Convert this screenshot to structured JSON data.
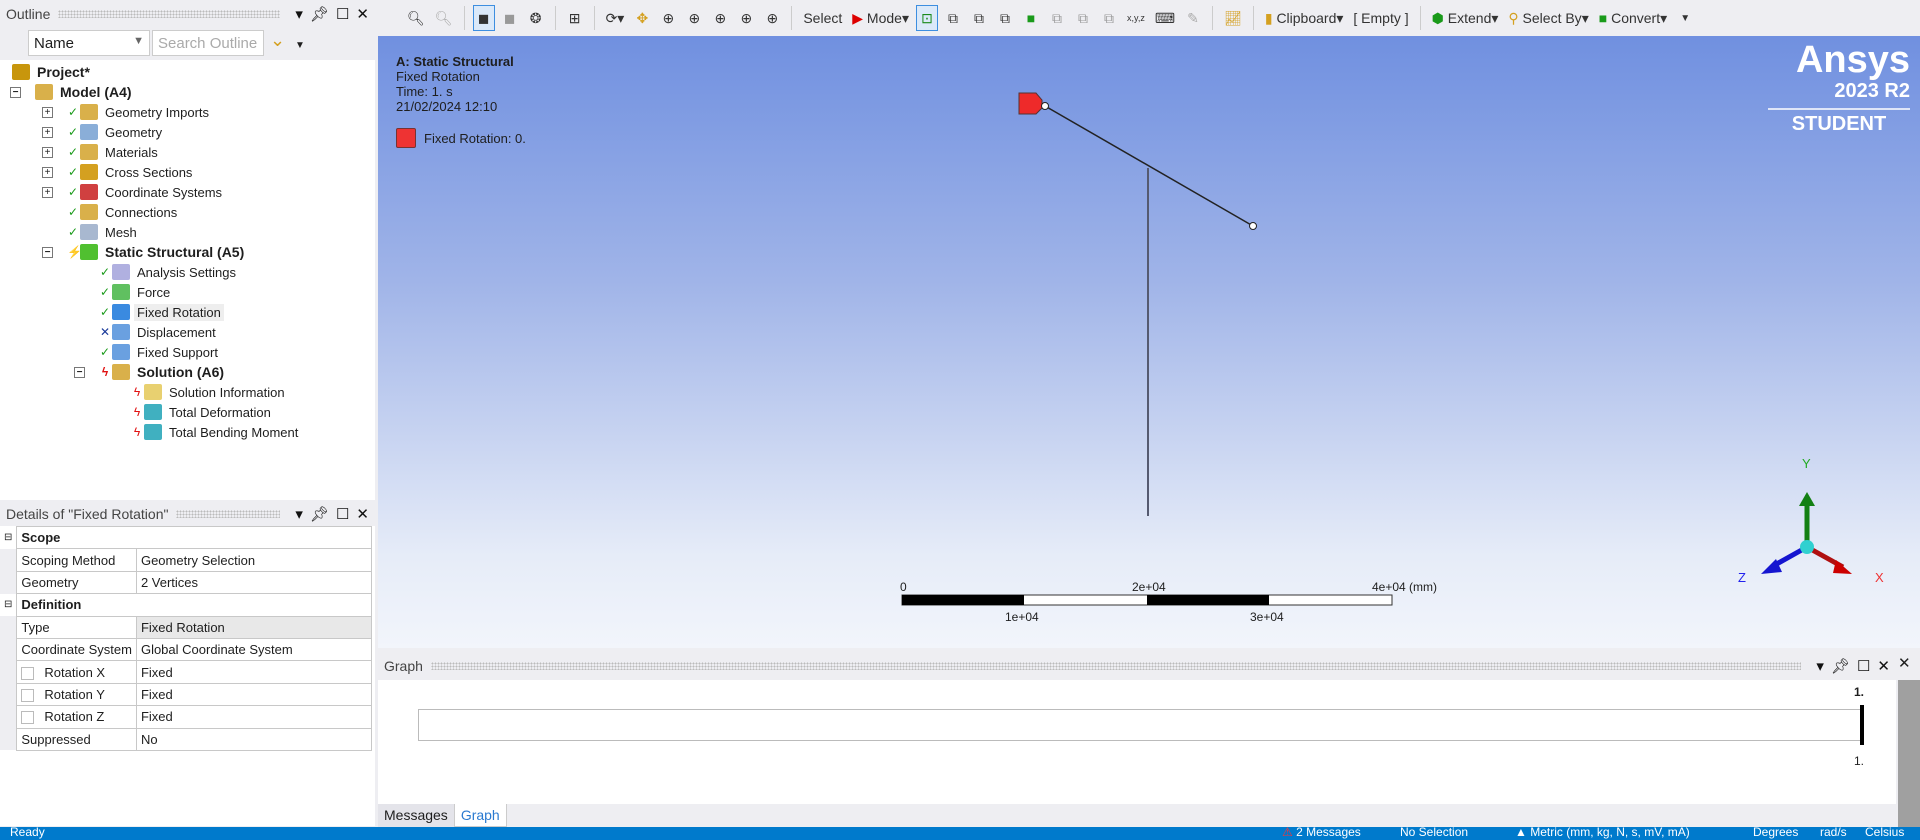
{
  "outline": {
    "title": "Outline",
    "filter_value": "Name",
    "search_placeholder": "Search Outline"
  },
  "tree": [
    {
      "label": "Project*",
      "bold": true,
      "icon": "project-icon",
      "status": ""
    },
    {
      "label": "Model (A4)",
      "bold": true,
      "icon": "model-icon",
      "status": ""
    },
    {
      "label": "Geometry Imports",
      "icon": "folder-icon",
      "status": "check"
    },
    {
      "label": "Geometry",
      "icon": "geometry-icon",
      "status": "check"
    },
    {
      "label": "Materials",
      "icon": "materials-icon",
      "status": "check"
    },
    {
      "label": "Cross Sections",
      "icon": "cross-section-icon",
      "status": "check"
    },
    {
      "label": "Coordinate Systems",
      "icon": "coordinate-icon",
      "status": "check"
    },
    {
      "label": "Connections",
      "icon": "connections-icon",
      "status": "check"
    },
    {
      "label": "Mesh",
      "icon": "mesh-icon",
      "status": "check"
    },
    {
      "label": "Static Structural (A5)",
      "bold": true,
      "icon": "static-structural-icon",
      "status": "lightning"
    },
    {
      "label": "Analysis Settings",
      "icon": "analysis-settings-icon",
      "status": "check"
    },
    {
      "label": "Force",
      "icon": "force-icon",
      "status": "check"
    },
    {
      "label": "Fixed Rotation",
      "icon": "fixed-rotation-icon",
      "status": "check"
    },
    {
      "label": "Displacement",
      "icon": "displacement-icon",
      "status": "x"
    },
    {
      "label": "Fixed Support",
      "icon": "fixed-support-icon",
      "status": "check"
    },
    {
      "label": "Solution (A6)",
      "bold": true,
      "icon": "solution-icon",
      "status": "bolt"
    },
    {
      "label": "Solution Information",
      "icon": "solution-info-icon",
      "status": "bolt"
    },
    {
      "label": "Total Deformation",
      "icon": "result-icon",
      "status": "bolt"
    },
    {
      "label": "Total Bending Moment",
      "icon": "result-icon",
      "status": "bolt"
    }
  ],
  "details": {
    "title": "Details of \"Fixed Rotation\"",
    "sections": [
      {
        "name": "Scope",
        "rows": [
          [
            "Scoping Method",
            "Geometry Selection"
          ],
          [
            "Geometry",
            "2 Vertices"
          ]
        ]
      },
      {
        "name": "Definition",
        "rows": [
          [
            "Type",
            "Fixed Rotation"
          ],
          [
            "Coordinate System",
            "Global Coordinate System"
          ],
          [
            "Rotation X",
            "Fixed"
          ],
          [
            "Rotation Y",
            "Fixed"
          ],
          [
            "Rotation Z",
            "Fixed"
          ],
          [
            "Suppressed",
            "No"
          ]
        ]
      }
    ]
  },
  "toolbar": {
    "select": "Select",
    "mode": "Mode",
    "clipboard": "Clipboard",
    "empty": "[ Empty ]",
    "extend": "Extend",
    "select_by": "Select By",
    "convert": "Convert"
  },
  "viewport": {
    "title": "A: Static Structural",
    "subtitle": "Fixed Rotation",
    "time": "Time: 1. s",
    "date": "21/02/2024 12:10",
    "legend": "Fixed Rotation: 0.",
    "legend_color": "#ee3333",
    "logo": {
      "brand": "Ansys",
      "version": "2023 R2",
      "edition": "STUDENT"
    },
    "scale": {
      "t0": "0",
      "t2": "2e+04",
      "t4": "4e+04 (mm)",
      "t1": "1e+04",
      "t3": "3e+04"
    },
    "axes": {
      "x": "X",
      "y": "Y",
      "z": "Z"
    }
  },
  "graph": {
    "title": "Graph",
    "top_label": "1.",
    "bottom_label": "1."
  },
  "tabs": {
    "messages": "Messages",
    "graph": "Graph"
  },
  "status": {
    "left": "Ready",
    "messages": "2 Messages",
    "selection": "No Selection",
    "units": "Metric (mm, kg, N, s, mV, mA)",
    "angle": "Degrees",
    "rate": "rad/s",
    "temp": "Celsius"
  }
}
